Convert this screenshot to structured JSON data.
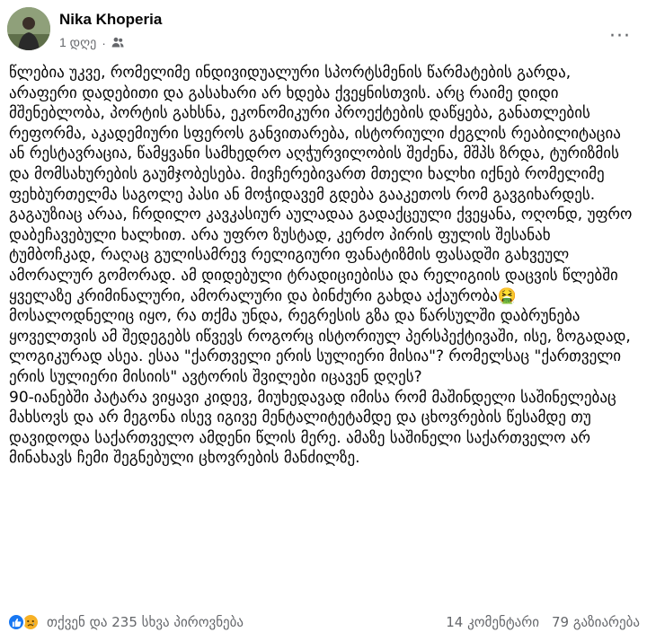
{
  "post": {
    "author": "Nika Khoperia",
    "time": "1 დღე",
    "paragraphs": [
      "წლებია უკვე, რომელიმე ინდივიდუალური სპორტსმენის წარმატების გარდა, არაფერი დადებითი და გასახარი არ ხდება ქვეყნისთვის. არც რაიმე დიდი მშენებლობა, პორტის გახსნა, ეკონომიკური პროექტების დაწყება, განათლების რეფორმა, აკადემიური სფეროს განვითარება, ისტორიული ძეგლის რეაბილიტაცია ან რესტავრაცია, წამყვანი სამხედრო აღჭურვილობის შეძენა, მშპს ზრდა, ტურიზმის და მომსახურების გაუმჯობესება. მივჩერებივართ მთელი ხალხი იქნებ რომელიმე ფეხბურთელმა საგოლე პასი ან მოჭიდავემ გდება გააკეთოს რომ გავგიხარდეს. გაგაუზიაც არაა, ჩრდილო კავკასიურ აულადაა გადაქცეული ქვეყანა, ოღონდ, უფრო დაბეჩავებული ხალხით. არა უფრო ზუსტად, კერძო პირის ფულის შესანახ ტუმბოჩკად, რაღაც გულისამრევ რელიგიური ფანატიზმის ფასადში გახვეულ ამორალურ გომორად. ამ დიდებული ტრადიციებისა და რელიგიის დაცვის წლებში ყველაზე კრიმინალური, ამორალური და ბინძური გახდა აქაურობა🤮",
      "მოსალოდნელიც იყო, რა თქმა უნდა, რეგრესის გზა და წარსულში დაბრუნება ყოველთვის ამ შედეგებს იწვევს როგორც ისტორიულ პერსპექტივაში, ისე, ზოგადად, ლოგიკურად ასეა. ესაა \"ქართველი ერის სულიერი მისია\"? რომელსაც \"ქართველი ერის სულიერი მისიის\" ავტორის შვილები იცავენ დღეს?",
      "90-იანებში პატარა ვიყავი კიდევ, მიუხედავად იმისა რომ მაშინდელი საშინელებაც მახსოვს და არ მეგონა ისევ იგივე მენტალიტეტამდე და ცხოვრების წესამდე თუ დავიდოდა საქართველო ამდენი წლის მერე. ამაზე საშინელი საქართველო არ მინახავს ჩემი შეგნებული ცხოვრების მანძილზე."
    ]
  },
  "footer": {
    "reactions_text": "თქვენ და 235 სხვა პიროვნება",
    "comments": "14 კომენტარი",
    "shares": "79 გაზიარება"
  },
  "colors": {
    "like_blue": "#1877f2",
    "sad_yellow": "#f7b125",
    "secondary_text": "#65676b"
  },
  "icons": {
    "audience": "friends-icon",
    "menu": "more-options-icon"
  }
}
